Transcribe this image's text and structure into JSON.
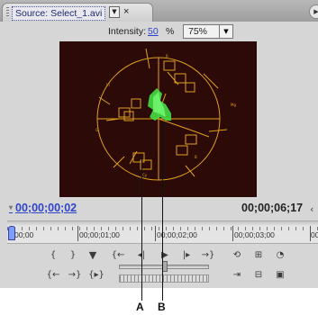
{
  "tab": {
    "title": "Source: Select_1.avi",
    "menu_icon": "triangle-down-icon",
    "close_label": "×"
  },
  "toolbar": {
    "intensity_label": "Intensity:",
    "intensity_value": "50",
    "intensity_unit": "%",
    "zoom_value": "75%"
  },
  "scope": {
    "background": "#2b0a08",
    "graticule_color": "#e0a020",
    "trace_color": "#44dd44",
    "targets": [
      "R",
      "Mg",
      "B",
      "Cy",
      "G",
      "YI"
    ]
  },
  "timecode": {
    "current": "00;00;00;02",
    "duration": "00;00;06;17"
  },
  "ruler": {
    "labels": [
      "00;00",
      "00;00;01;00",
      "00;00;02;00",
      "00;00;03;00",
      "00"
    ]
  },
  "controls": {
    "row1": [
      "mark-in-icon",
      "mark-out-icon",
      "set-marker-icon",
      "goto-in-icon",
      "step-back-icon",
      "play-icon",
      "step-forward-icon",
      "goto-out-icon",
      "loop-icon",
      "safe-margins-icon",
      "output-icon"
    ],
    "row2": [
      "goto-previous-marker-icon",
      "goto-next-marker-icon",
      "play-in-to-out-icon",
      "insert-icon",
      "overlay-icon",
      "export-frame-icon"
    ]
  },
  "callouts": {
    "a": "A",
    "b": "B"
  }
}
